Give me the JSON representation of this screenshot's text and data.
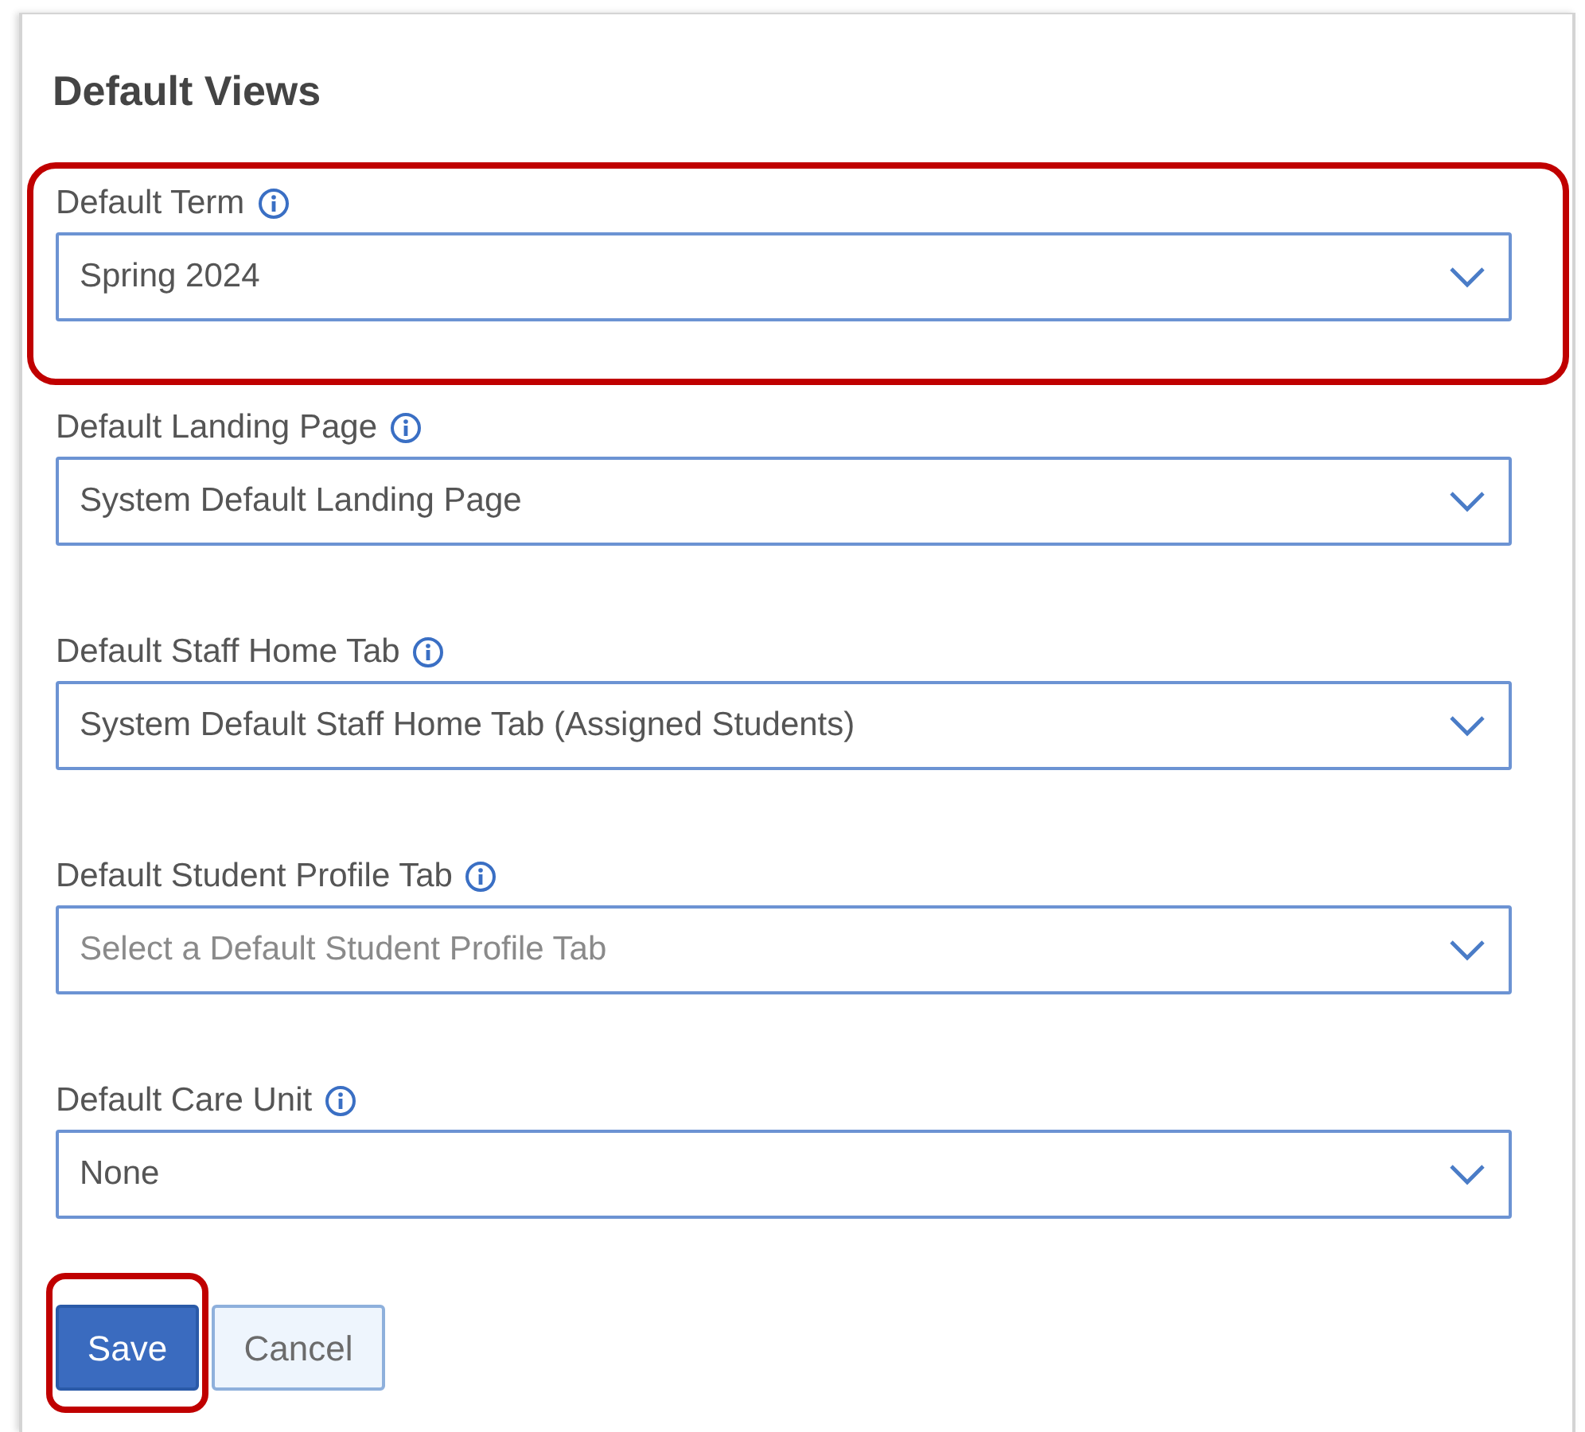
{
  "panel": {
    "title": "Default Views"
  },
  "fields": [
    {
      "label": "Default Term",
      "value": "Spring 2024",
      "highlighted": true
    },
    {
      "label": "Default Landing Page",
      "value": "System Default Landing Page",
      "highlighted": false
    },
    {
      "label": "Default Staff Home Tab",
      "value": "System Default Staff Home Tab (Assigned Students)",
      "highlighted": false
    },
    {
      "label": "Default Student Profile Tab",
      "placeholder": "Select a Default Student Profile Tab",
      "highlighted": false
    },
    {
      "label": "Default Care Unit",
      "value": "None",
      "highlighted": false
    }
  ],
  "buttons": [
    {
      "label": "Save",
      "kind": "primary",
      "highlighted": true
    },
    {
      "label": "Cancel",
      "kind": "secondary",
      "highlighted": false
    }
  ]
}
